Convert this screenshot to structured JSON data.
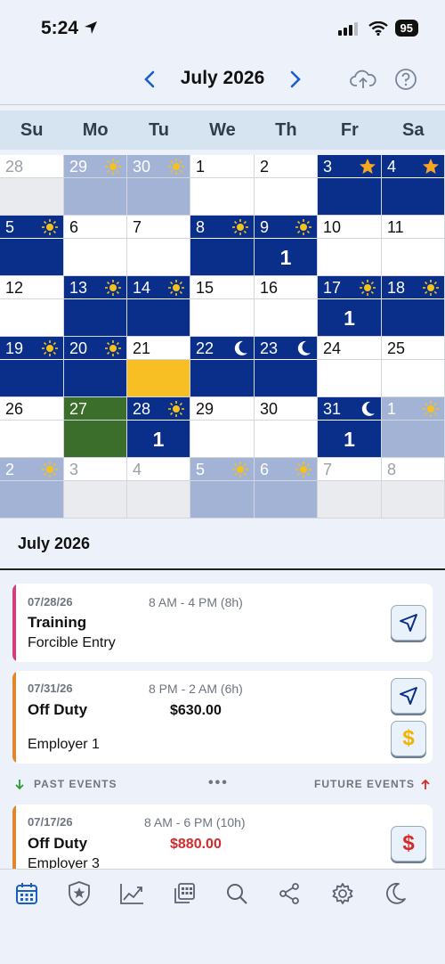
{
  "status_bar": {
    "time": "5:24",
    "battery": "95"
  },
  "header": {
    "month_title": "July 2026"
  },
  "weekdays": [
    "Su",
    "Mo",
    "Tu",
    "We",
    "Th",
    "Fr",
    "Sa"
  ],
  "calendar": {
    "rows": [
      [
        {
          "num": "28",
          "type": "other",
          "icon": ""
        },
        {
          "num": "29",
          "type": "other-shift",
          "icon": "sun"
        },
        {
          "num": "30",
          "type": "other-shift",
          "icon": "sun"
        },
        {
          "num": "1",
          "type": "plain",
          "icon": ""
        },
        {
          "num": "2",
          "type": "plain",
          "icon": ""
        },
        {
          "num": "3",
          "type": "shift",
          "icon": "star"
        },
        {
          "num": "4",
          "type": "shift",
          "icon": "star"
        }
      ],
      [
        {
          "num": "5",
          "type": "shift",
          "icon": "sun"
        },
        {
          "num": "6",
          "type": "plain",
          "icon": ""
        },
        {
          "num": "7",
          "type": "plain",
          "icon": ""
        },
        {
          "num": "8",
          "type": "shift",
          "icon": "sun"
        },
        {
          "num": "9",
          "type": "shift",
          "icon": "sun",
          "count": "1"
        },
        {
          "num": "10",
          "type": "plain",
          "icon": ""
        },
        {
          "num": "11",
          "type": "plain",
          "icon": ""
        }
      ],
      [
        {
          "num": "12",
          "type": "plain",
          "icon": ""
        },
        {
          "num": "13",
          "type": "shift",
          "icon": "sun"
        },
        {
          "num": "14",
          "type": "shift",
          "icon": "sun"
        },
        {
          "num": "15",
          "type": "plain",
          "icon": ""
        },
        {
          "num": "16",
          "type": "plain",
          "icon": ""
        },
        {
          "num": "17",
          "type": "shift",
          "icon": "sun",
          "count": "1"
        },
        {
          "num": "18",
          "type": "shift",
          "icon": "sun"
        }
      ],
      [
        {
          "num": "19",
          "type": "shift",
          "icon": "sun"
        },
        {
          "num": "20",
          "type": "shift",
          "icon": "sun"
        },
        {
          "num": "21",
          "type": "today",
          "icon": ""
        },
        {
          "num": "22",
          "type": "shift",
          "icon": "moon"
        },
        {
          "num": "23",
          "type": "shift",
          "icon": "moon"
        },
        {
          "num": "24",
          "type": "plain",
          "icon": ""
        },
        {
          "num": "25",
          "type": "plain",
          "icon": ""
        }
      ],
      [
        {
          "num": "26",
          "type": "plain",
          "icon": ""
        },
        {
          "num": "27",
          "type": "green",
          "icon": ""
        },
        {
          "num": "28",
          "type": "shift",
          "icon": "sun",
          "count": "1"
        },
        {
          "num": "29",
          "type": "plain",
          "icon": ""
        },
        {
          "num": "30",
          "type": "plain",
          "icon": ""
        },
        {
          "num": "31",
          "type": "shift",
          "icon": "moon",
          "count": "1"
        },
        {
          "num": "1",
          "type": "other-shift",
          "icon": "sun"
        }
      ],
      [
        {
          "num": "2",
          "type": "other-shift",
          "icon": "sun"
        },
        {
          "num": "3",
          "type": "other",
          "icon": ""
        },
        {
          "num": "4",
          "type": "other",
          "icon": ""
        },
        {
          "num": "5",
          "type": "other-shift",
          "icon": "sun"
        },
        {
          "num": "6",
          "type": "other-shift",
          "icon": "sun"
        },
        {
          "num": "7",
          "type": "other",
          "icon": ""
        },
        {
          "num": "8",
          "type": "other",
          "icon": ""
        }
      ]
    ]
  },
  "list": {
    "title": "July 2026",
    "events": [
      {
        "date": "07/28/26",
        "time": "8 AM - 4 PM (8h)",
        "title": "Training",
        "subtitle": "Forcible Entry",
        "amount": "",
        "color": "#d63b7a"
      },
      {
        "date": "07/31/26",
        "time": "8 PM - 2 AM (6h)",
        "title": "Off Duty",
        "subtitle": "Employer 1",
        "amount": "$630.00",
        "color": "#e2862a"
      },
      {
        "date": "07/17/26",
        "time": "8 AM - 6 PM (10h)",
        "title": "Off Duty",
        "subtitle": "Employer 3",
        "amount": "$880.00",
        "color": "#e2862a"
      }
    ]
  },
  "events_bar": {
    "past": "PAST EVENTS",
    "future": "FUTURE EVENTS",
    "more": "•••"
  },
  "colors": {
    "shift": "#0a2f8a",
    "other_shift": "#a3b3d6",
    "other": "#e9ebef",
    "today": "#f7bf24",
    "green": "#3a6e2a",
    "accent": "#1a5fc8"
  },
  "tab_bar": [
    "calendar-icon",
    "badge-icon",
    "chart-icon",
    "reports-icon",
    "search-icon",
    "share-icon",
    "settings-icon",
    "moon-icon"
  ]
}
